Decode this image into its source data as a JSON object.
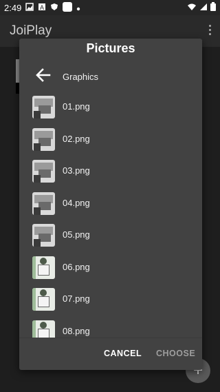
{
  "status": {
    "time": "2:49"
  },
  "app": {
    "title": "JoiPlay"
  },
  "dialog": {
    "title": "Pictures",
    "folder": "Graphics",
    "files": [
      {
        "name": "01.png",
        "thumb": "dark"
      },
      {
        "name": "02.png",
        "thumb": "dark"
      },
      {
        "name": "03.png",
        "thumb": "dark"
      },
      {
        "name": "04.png",
        "thumb": "dark"
      },
      {
        "name": "05.png",
        "thumb": "dark"
      },
      {
        "name": "06.png",
        "thumb": "light"
      },
      {
        "name": "07.png",
        "thumb": "light"
      },
      {
        "name": "08.png",
        "thumb": "light"
      }
    ],
    "cancel_label": "CANCEL",
    "choose_label": "CHOOSE"
  },
  "fab": {
    "icon": "plus-icon"
  }
}
